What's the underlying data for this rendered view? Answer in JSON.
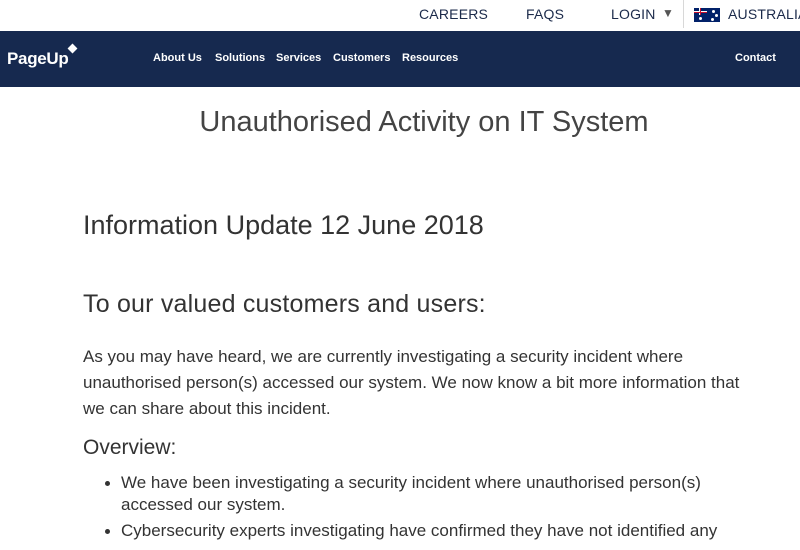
{
  "utility": {
    "careers": "CAREERS",
    "faqs": "FAQS",
    "login": "LOGIN",
    "caret": "▼",
    "country": "AUSTRALIA"
  },
  "nav": {
    "logo": "PageUp",
    "items": [
      "About Us",
      "Solutions",
      "Services",
      "Customers",
      "Resources"
    ],
    "contact": "Contact"
  },
  "colors": {
    "nav_bg": "#16294f",
    "text": "#333333"
  },
  "content": {
    "title": "Unauthorised Activity on IT System",
    "update_heading": "Information Update 12 June 2018",
    "greeting": "To our valued customers and users:",
    "intro_lines": [
      "As you may have heard, we are currently investigating a security incident where",
      "unauthorised person(s) accessed our system. We now know a bit more information that",
      "we can share about this incident."
    ],
    "overview_heading": "Overview:",
    "bullets": [
      {
        "lines": [
          "We have been investigating a security incident where unauthorised person(s)",
          "accessed our system."
        ]
      },
      {
        "lines": [
          "Cybersecurity experts investigating have confirmed they have not identified any"
        ]
      }
    ]
  }
}
